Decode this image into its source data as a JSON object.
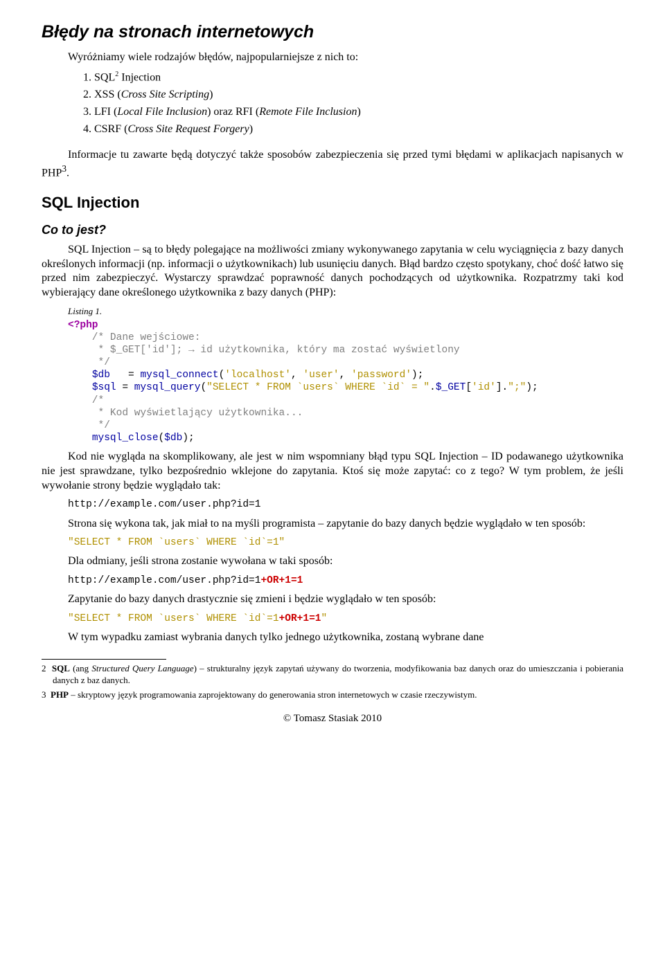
{
  "mainTitle": "Błędy na stronach internetowych",
  "intro": "Wyróżniamy wiele rodzajów błędów, najpopularniejsze z nich to:",
  "list": [
    {
      "num": "1.",
      "text1": "SQL",
      "sup": "2",
      "text2": " Injection"
    },
    {
      "num": "2.",
      "text1": "XSS (",
      "italic": "Cross Site Scripting",
      "text2": ")"
    },
    {
      "num": "3.",
      "text1": "LFI (",
      "italic": "Local File Inclusion",
      "text2": ") oraz RFI (",
      "italic2": "Remote File Inclusion",
      "text3": ")"
    },
    {
      "num": "4.",
      "text1": "CSRF (",
      "italic": "Cross Site Request Forgery",
      "text2": ")"
    }
  ],
  "para1_a": "Informacje tu zawarte będą dotyczyć także sposobów zabezpieczenia się przed tymi błędami w aplikacjach napisanych w PHP",
  "para1_sup": "3",
  "para1_b": ".",
  "sectionTitle": "SQL Injection",
  "subsectionTitle": "Co to jest?",
  "body1": "SQL Injection – są to błędy polegające na możliwości zmiany wykonywanego zapytania w celu wyciągnięcia z bazy danych określonych informacji (np. informacji o użytkownikach) lub usunięciu danych. Błąd bardzo często spotykany, choć dość łatwo się przed nim zabezpieczyć. Wystarczy sprawdzać poprawność danych pochodzących od użytkownika. Rozpatrzmy taki kod wybierający dane określonego użytkownika z bazy danych (PHP):",
  "listingLabel": "Listing 1.",
  "code": {
    "phpOpen": "<?php",
    "c1": "    /* Dane wejściowe:",
    "c2": "     * $_GET['id']; → id użytkownika, który ma zostać wyświetlony",
    "c3": "     */",
    "l1": {
      "var": "$db",
      "mid": "   = ",
      "func": "mysql_connect",
      "paren": "(",
      "s1": "'localhost'",
      "comma1": ", ",
      "s2": "'user'",
      "comma2": ", ",
      "s3": "'password'",
      "close": ");"
    },
    "l2": {
      "var": "$sql",
      "mid": " = ",
      "func": "mysql_query",
      "paren": "(",
      "s1": "\"SELECT * FROM `users` WHERE `id` = \"",
      "dot1": ".",
      "var2": "$_GET",
      "idx": "[",
      "s2": "'id'",
      "idx2": "]",
      "dot2": ".",
      "s3": "\";\"",
      "close": ");"
    },
    "c4": "    /*",
    "c5": "     * Kod wyświetlający użytkownika...",
    "c6": "     */",
    "l3": {
      "func": "mysql_close",
      "paren": "(",
      "var": "$db",
      "close": ");"
    }
  },
  "body2": "Kod nie wygląda na skomplikowany, ale jest w nim wspomniany błąd typu SQL Injection – ID podawanego użytkownika nie jest sprawdzane, tylko bezpośrednio wklejone do zapytania. Ktoś się może zapytać: co z tego? W tym problem, że jeśli wywołanie strony będzie wyglądało tak:",
  "url1": "http://example.com/user.php?id=1",
  "body3": "Strona się wykona tak, jak miał to na myśli programista – zapytanie do bazy danych będzie wyglądało w ten sposób:",
  "sql1": "\"SELECT * FROM `users` WHERE `id`=1\"",
  "body4": "Dla odmiany, jeśli strona zostanie wywołana w taki sposób:",
  "url2_a": "http://example.com/user.php?id=1",
  "url2_b": "+OR+1=1",
  "body5": "Zapytanie do bazy danych drastycznie się zmieni i będzie wyglądało w ten sposób:",
  "sql2_a": "\"SELECT * FROM `users` WHERE `id`=1",
  "sql2_b": "+OR+1=1",
  "sql2_c": "\"",
  "body6": "W tym wypadku zamiast wybrania danych tylko jednego użytkownika, zostaną wybrane dane",
  "footnotes": [
    {
      "num": "2",
      "boldPart": "SQL",
      "normalPart": " (ang ",
      "italicPart": "Structured Query Language",
      "rest": ") – strukturalny język zapytań używany do tworzenia, modyfikowania baz danych oraz do umieszczania i pobierania danych z baz danych."
    },
    {
      "num": "3",
      "boldPart": "PHP",
      "rest": " – skryptowy język programowania zaprojektowany do generowania stron internetowych w czasie rzeczywistym."
    }
  ],
  "footer": "© Tomasz Stasiak 2010"
}
